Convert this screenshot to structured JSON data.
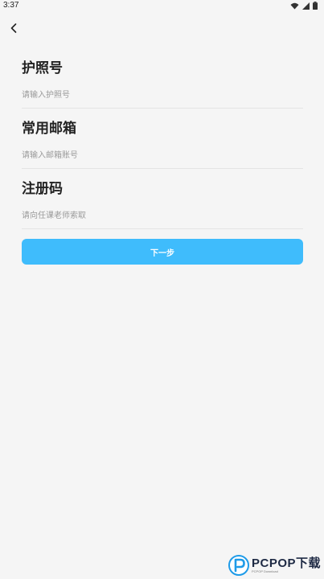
{
  "status_bar": {
    "time": "3:37"
  },
  "nav": {
    "back_icon": "chevron-left-icon"
  },
  "form": {
    "fields": [
      {
        "title": "护照号",
        "placeholder": "请输入护照号",
        "value": ""
      },
      {
        "title": "常用邮箱",
        "placeholder": "请输入邮箱账号",
        "value": ""
      },
      {
        "title": "注册码",
        "placeholder": "请向任课老师索取",
        "value": ""
      }
    ],
    "next_label": "下一步"
  },
  "watermark": {
    "brand": "PCPOP下载",
    "sub": "PCPOP Download"
  },
  "colors": {
    "background": "#f5f5f5",
    "button": "#3fbcfc",
    "button_text": "#ffffff",
    "placeholder": "#9a9a9a",
    "divider": "#e4e4e4"
  }
}
